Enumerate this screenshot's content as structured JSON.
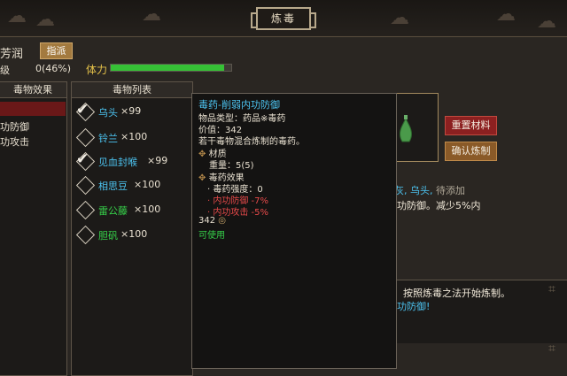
{
  "window": {
    "title": "炼毒"
  },
  "header": {
    "name": "芳润",
    "assign_label": "指派",
    "level_label": "级",
    "level_value": "0(46%)",
    "stamina_label": "体力",
    "stamina_fraction": 0.94
  },
  "effects_panel": {
    "header": "毒物效果",
    "items": [
      "功防御",
      "功攻击"
    ]
  },
  "poison_list": {
    "header": "毒物列表",
    "items": [
      {
        "name": "乌头",
        "qty": "×99",
        "checked": true,
        "color": "#4cc3f0"
      },
      {
        "name": "铃兰",
        "qty": "×100",
        "checked": false,
        "color": "#4cc3f0"
      },
      {
        "name": "见血封喉",
        "qty": "×99",
        "checked": true,
        "color": "#4cc3f0"
      },
      {
        "name": "相思豆",
        "qty": "×100",
        "checked": false,
        "color": "#4cc3f0"
      },
      {
        "name": "雷公藤",
        "qty": "×100",
        "checked": false,
        "color": "#36d24a"
      },
      {
        "name": "胆矾",
        "qty": "×100",
        "checked": false,
        "color": "#36d24a"
      }
    ]
  },
  "tooltip": {
    "title": "毒药-削弱内功防御",
    "type_line": "物品类型：药品※毒药",
    "value_line": "价值：342",
    "desc": "若干毒物混合炼制的毒药。",
    "material_header": "材质",
    "weight_line": "重量：5(5)",
    "effects_header": "毒药效果",
    "effect_lines": [
      "· 毒药强度：0",
      "· 内功防御 -7%",
      "· 内功攻击 -5%"
    ],
    "price": "342",
    "usable": "可使用"
  },
  "right_panel": {
    "reset_label": "重置材料",
    "confirm_label": "确认炼制",
    "added_prefix": "灰,",
    "added_item": "乌头,",
    "added_suffix": "待添加",
    "effect_desc": "功防御。减少5%内",
    "log_line1": "按照炼毒之法开始炼制。",
    "log_line2": "功防御!"
  }
}
